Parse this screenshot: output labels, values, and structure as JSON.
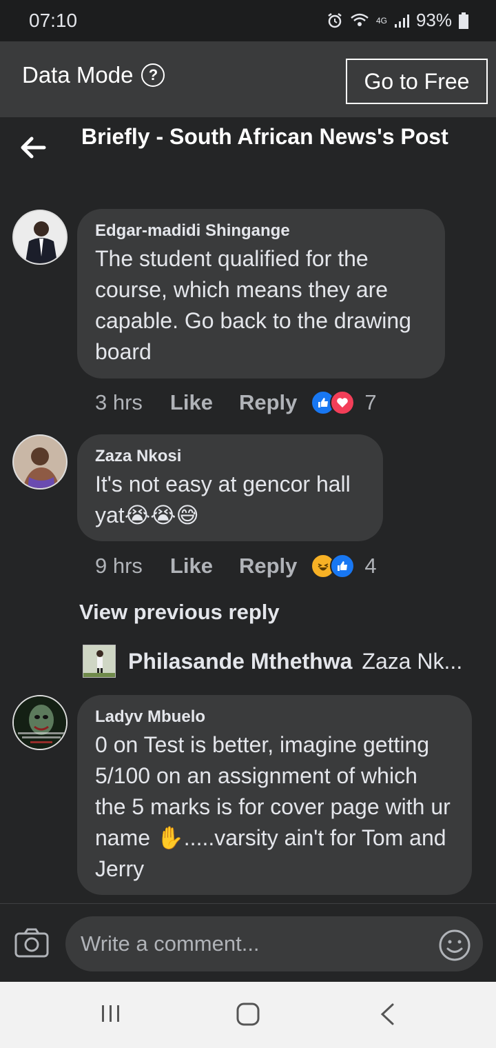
{
  "status_bar": {
    "time": "07:10",
    "battery": "93%",
    "network": "4G"
  },
  "data_mode": {
    "label": "Data Mode",
    "button": "Go to Free"
  },
  "header": {
    "title": "Briefly - South African News's Post"
  },
  "comments": [
    {
      "author": "Edgar-madidi Shingange",
      "text": "The student qualified for the course, which means they are capable. Go back to the drawing board",
      "time": "3 hrs",
      "like": "Like",
      "reply": "Reply",
      "reaction_count": "7",
      "reactions": [
        "like-icon",
        "love-icon"
      ]
    },
    {
      "author": "Zaza Nkosi",
      "text": "It's not easy at gencor hall yat😭😭😅",
      "time": "9 hrs",
      "like": "Like",
      "reply": "Reply",
      "reaction_count": "4",
      "reactions": [
        "haha-icon",
        "like-icon"
      ]
    },
    {
      "author": "Ladyv Mbuelo",
      "text": "0 on Test is better, imagine getting 5/100 on an assignment of which the 5 marks is for cover page with ur name ✋.....varsity ain't for Tom and Jerry"
    }
  ],
  "view_previous": "View previous reply",
  "reply_preview": {
    "author": "Philasande Mthethwa",
    "text": "Zaza Nk..."
  },
  "composer": {
    "placeholder": "Write a comment..."
  },
  "colors": {
    "background": "#242526",
    "bubble": "#3a3b3c",
    "like_blue": "#1877f2",
    "love_red": "#f33e58"
  }
}
